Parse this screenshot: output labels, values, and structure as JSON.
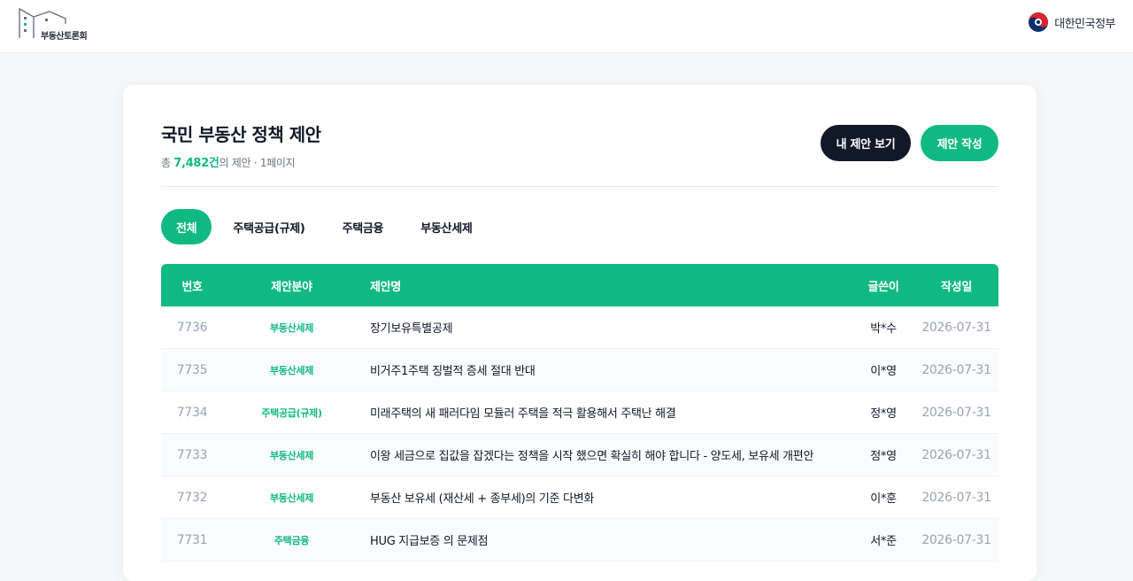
{
  "header": {
    "logo_text": "부동산토론회",
    "gov_text": "대한민국정부"
  },
  "board": {
    "title": "국민 부동산 정책 제안",
    "sub_prefix": "총 ",
    "count": "7,482건",
    "sub_suffix": "의 제안 · 1페이지",
    "my_button": "내 제안 보기",
    "write_button": "제안 작성"
  },
  "tabs": [
    {
      "label": "전체",
      "active": true
    },
    {
      "label": "주택공급(규제)",
      "active": false
    },
    {
      "label": "주택금융",
      "active": false
    },
    {
      "label": "부동산세제",
      "active": false
    }
  ],
  "table": {
    "headers": {
      "no": "번호",
      "category": "제안분야",
      "title": "제안명",
      "writer": "글쓴이",
      "date": "작성일"
    },
    "rows": [
      {
        "no": "7736",
        "category": "부동산세제",
        "title": "장기보유특별공제",
        "writer": "박*수",
        "date": "2026-07-31"
      },
      {
        "no": "7735",
        "category": "부동산세제",
        "title": "비거주1주택 징벌적 증세 절대 반대",
        "writer": "이*영",
        "date": "2026-07-31"
      },
      {
        "no": "7734",
        "category": "주택공급(규제)",
        "title": "미래주택의 새 패러다임 모듈러 주택을 적극 활용해서 주택난 해결",
        "writer": "정*영",
        "date": "2026-07-31"
      },
      {
        "no": "7733",
        "category": "부동산세제",
        "title": "이왕 세금으로 집값을 잡겠다는 정책을 시작 했으면 확실히 해야 합니다 - 양도세, 보유세 개편안",
        "writer": "정*영",
        "date": "2026-07-31"
      },
      {
        "no": "7732",
        "category": "부동산세제",
        "title": "부동산 보유세 (재산세 + 종부세)의 기준 다변화",
        "writer": "이*훈",
        "date": "2026-07-31"
      },
      {
        "no": "7731",
        "category": "주택금융",
        "title": "HUG 지급보증 의 문제점",
        "writer": "서*준",
        "date": "2026-07-31"
      }
    ]
  },
  "colors": {
    "accent": "#10b981",
    "dark_button": "#111827"
  }
}
